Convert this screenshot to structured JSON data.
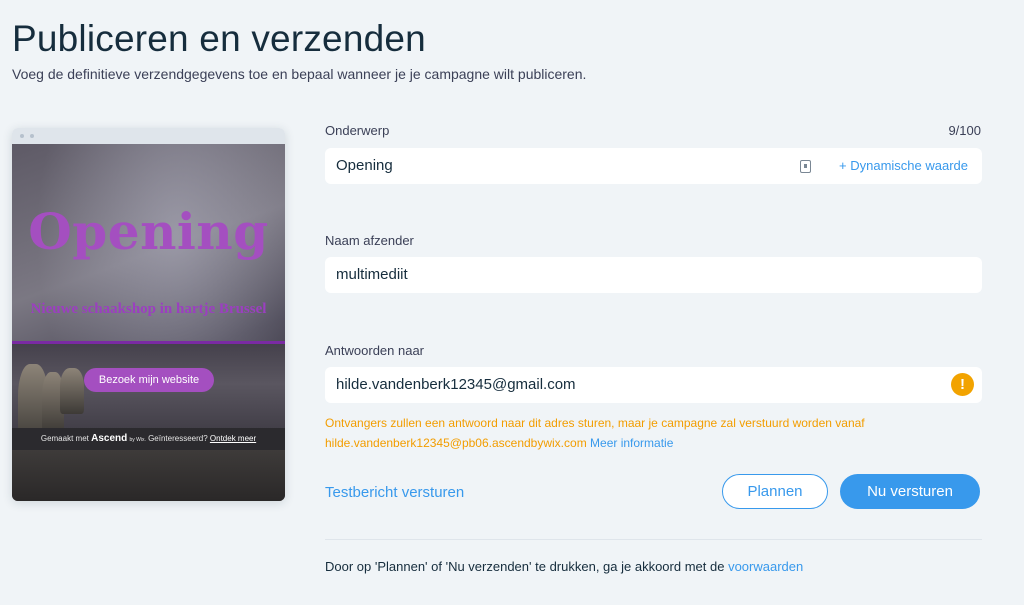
{
  "header": {
    "title": "Publiceren en verzenden",
    "subtitle": "Voeg de definitieve verzendgegevens toe en bepaal wanneer je je campagne wilt publiceren."
  },
  "preview": {
    "headline": "Opening",
    "subheadline": "Nieuwe schaakshop in hartje Brussel",
    "button_label": "Bezoek mijn website",
    "footer": {
      "made_with": "Gemaakt met",
      "brand": "Ascend",
      "by": "by Wix.",
      "interested": "Geïnteresseerd?",
      "discover": "Ontdek meer"
    }
  },
  "form": {
    "subject": {
      "label": "Onderwerp",
      "counter": "9/100",
      "value": "Opening",
      "dynamic_label": "+ Dynamische waarde"
    },
    "sender_name": {
      "label": "Naam afzender",
      "value": "multimediit"
    },
    "reply_to": {
      "label": "Antwoorden naar",
      "value": "hilde.vandenberk12345@gmail.com",
      "warning_icon": "!",
      "warning_line1": "Ontvangers zullen een antwoord naar dit adres sturen, maar je campagne zal verstuurd worden vanaf",
      "warning_address": "hilde.vandenberk12345@pb06.ascendbywix.com",
      "warning_more": "Meer informatie"
    }
  },
  "actions": {
    "test_link": "Testbericht versturen",
    "schedule_label": "Plannen",
    "send_now_label": "Nu versturen"
  },
  "terms": {
    "text": "Door op 'Plannen' of 'Nu verzenden' te drukken, ga je akkoord met de",
    "link": "voorwaarden"
  },
  "colors": {
    "accent": "#3899ec",
    "warning": "#f2a300",
    "preview_purple": "#a44fc0"
  }
}
